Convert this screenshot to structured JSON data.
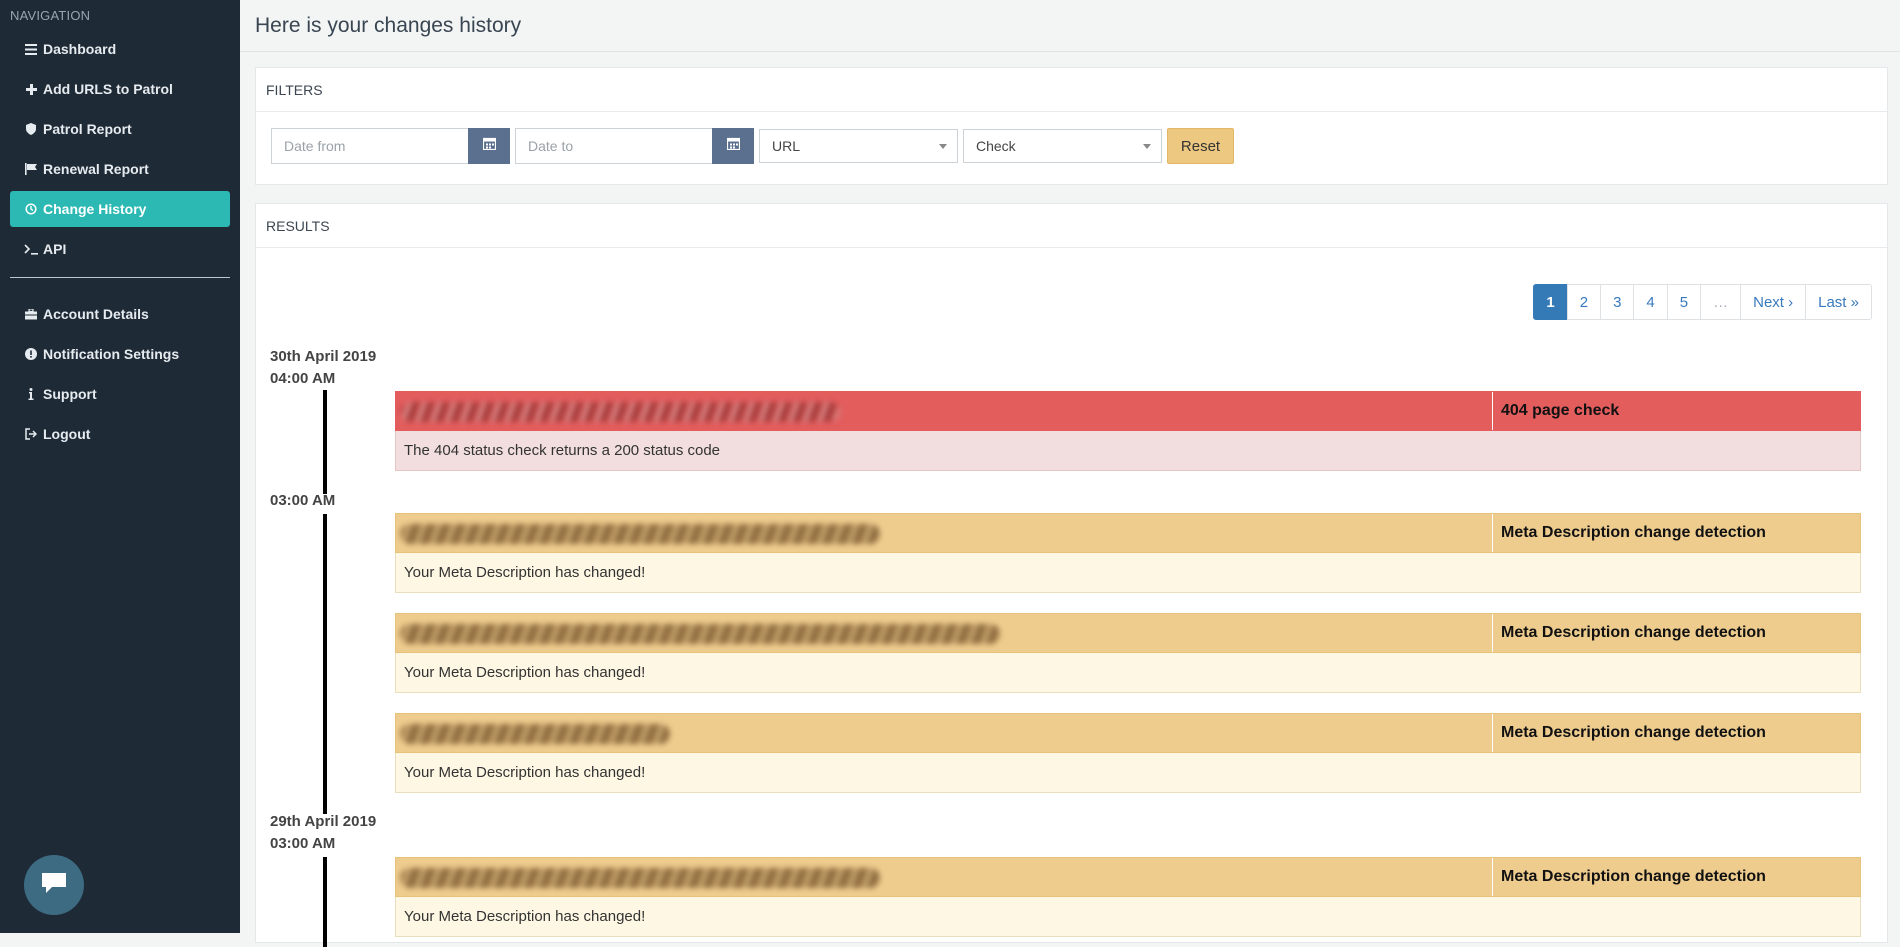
{
  "sidebar": {
    "header": "NAVIGATION",
    "items": [
      {
        "label": "Dashboard",
        "icon": "bars-icon"
      },
      {
        "label": "Add URLS to Patrol",
        "icon": "plus-icon"
      },
      {
        "label": "Patrol Report",
        "icon": "shield-icon"
      },
      {
        "label": "Renewal Report",
        "icon": "flag-icon"
      },
      {
        "label": "Change History",
        "icon": "history-icon",
        "active": true
      },
      {
        "label": "API",
        "icon": "terminal-icon"
      }
    ],
    "items2": [
      {
        "label": "Account Details",
        "icon": "briefcase-icon"
      },
      {
        "label": "Notification Settings",
        "icon": "exclamation-circle-icon"
      },
      {
        "label": "Support",
        "icon": "info-icon"
      },
      {
        "label": "Logout",
        "icon": "sign-out-icon"
      }
    ],
    "active_color": "#2cb8b3"
  },
  "page": {
    "title": "Here is your changes history"
  },
  "filters": {
    "title": "FILTERS",
    "date_from_placeholder": "Date from",
    "date_to_placeholder": "Date to",
    "url_select": "URL",
    "check_select": "Check",
    "reset_label": "Reset"
  },
  "results": {
    "title": "RESULTS",
    "pagination": [
      "1",
      "2",
      "3",
      "4",
      "5",
      "…",
      "Next ›",
      "Last »"
    ],
    "groups": [
      {
        "date": "30th April 2019",
        "time": "04:00 AM"
      },
      {
        "time": "03:00 AM"
      },
      {
        "date": "29th April 2019",
        "time": "03:00 AM"
      }
    ],
    "events": [
      {
        "check": "404 page check",
        "message": "The 404 status check returns a 200 status code",
        "status": "danger"
      },
      {
        "check": "Meta Description change detection",
        "message": "Your Meta Description has changed!",
        "status": "warning"
      },
      {
        "check": "Meta Description change detection",
        "message": "Your Meta Description has changed!",
        "status": "warning"
      },
      {
        "check": "Meta Description change detection",
        "message": "Your Meta Description has changed!",
        "status": "warning"
      },
      {
        "check": "Meta Description change detection",
        "message": "Your Meta Description has changed!",
        "status": "warning"
      }
    ]
  },
  "colors": {
    "sidebar_bg": "#1f2a37",
    "danger": "#e35d5d",
    "warning": "#eecc8e",
    "primary": "#337ab7"
  }
}
